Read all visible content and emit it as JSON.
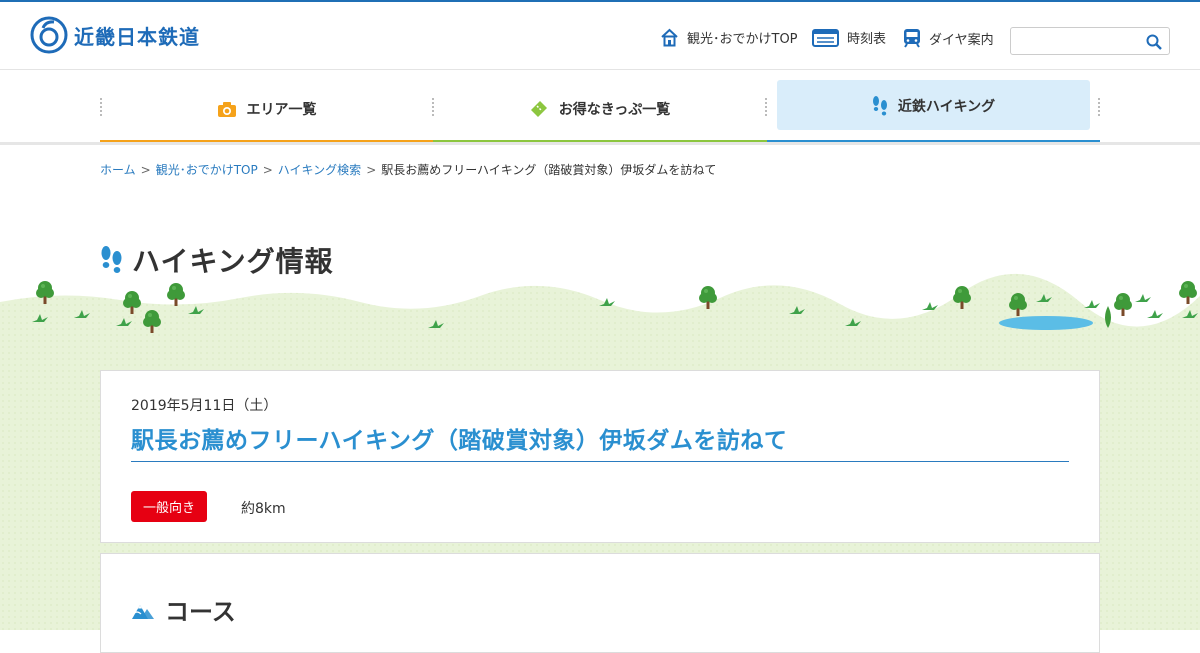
{
  "header": {
    "logo_text": "近畿日本鉄道",
    "links": [
      {
        "label": "観光･おでかけTOP",
        "icon": "home-icon"
      },
      {
        "label": "時刻表",
        "icon": "timetable-icon"
      },
      {
        "label": "ダイヤ案内",
        "icon": "train-icon"
      }
    ],
    "search_placeholder": ""
  },
  "main_nav": {
    "items": [
      {
        "label": "エリア一覧",
        "icon": "camera-icon",
        "color": "#f5a21a"
      },
      {
        "label": "お得なきっぷ一覧",
        "icon": "ticket-icon",
        "color": "#8cc63f"
      },
      {
        "label": "近鉄ハイキング",
        "icon": "footprints-icon",
        "color": "#2a8fd0",
        "active": true
      }
    ]
  },
  "breadcrumb": {
    "items": [
      "ホーム",
      "観光･おでかけTOP",
      "ハイキング検索"
    ],
    "separator": ">",
    "current": "駅長お薦めフリーハイキング（踏破賞対象）伊坂ダムを訪ねて"
  },
  "page_title": "ハイキング情報",
  "hiking": {
    "date": "2019年5月11日（土）",
    "title": "駅長お薦めフリーハイキング（踏破賞対象）伊坂ダムを訪ねて",
    "level_badge": "一般向き",
    "distance": "約8km"
  },
  "course": {
    "heading": "コース"
  },
  "colors": {
    "brand": "#1e6bb8",
    "link": "#2a7bbf",
    "title": "#2a8fd0",
    "badge": "#e60012",
    "grass": "#e6f2d4"
  }
}
